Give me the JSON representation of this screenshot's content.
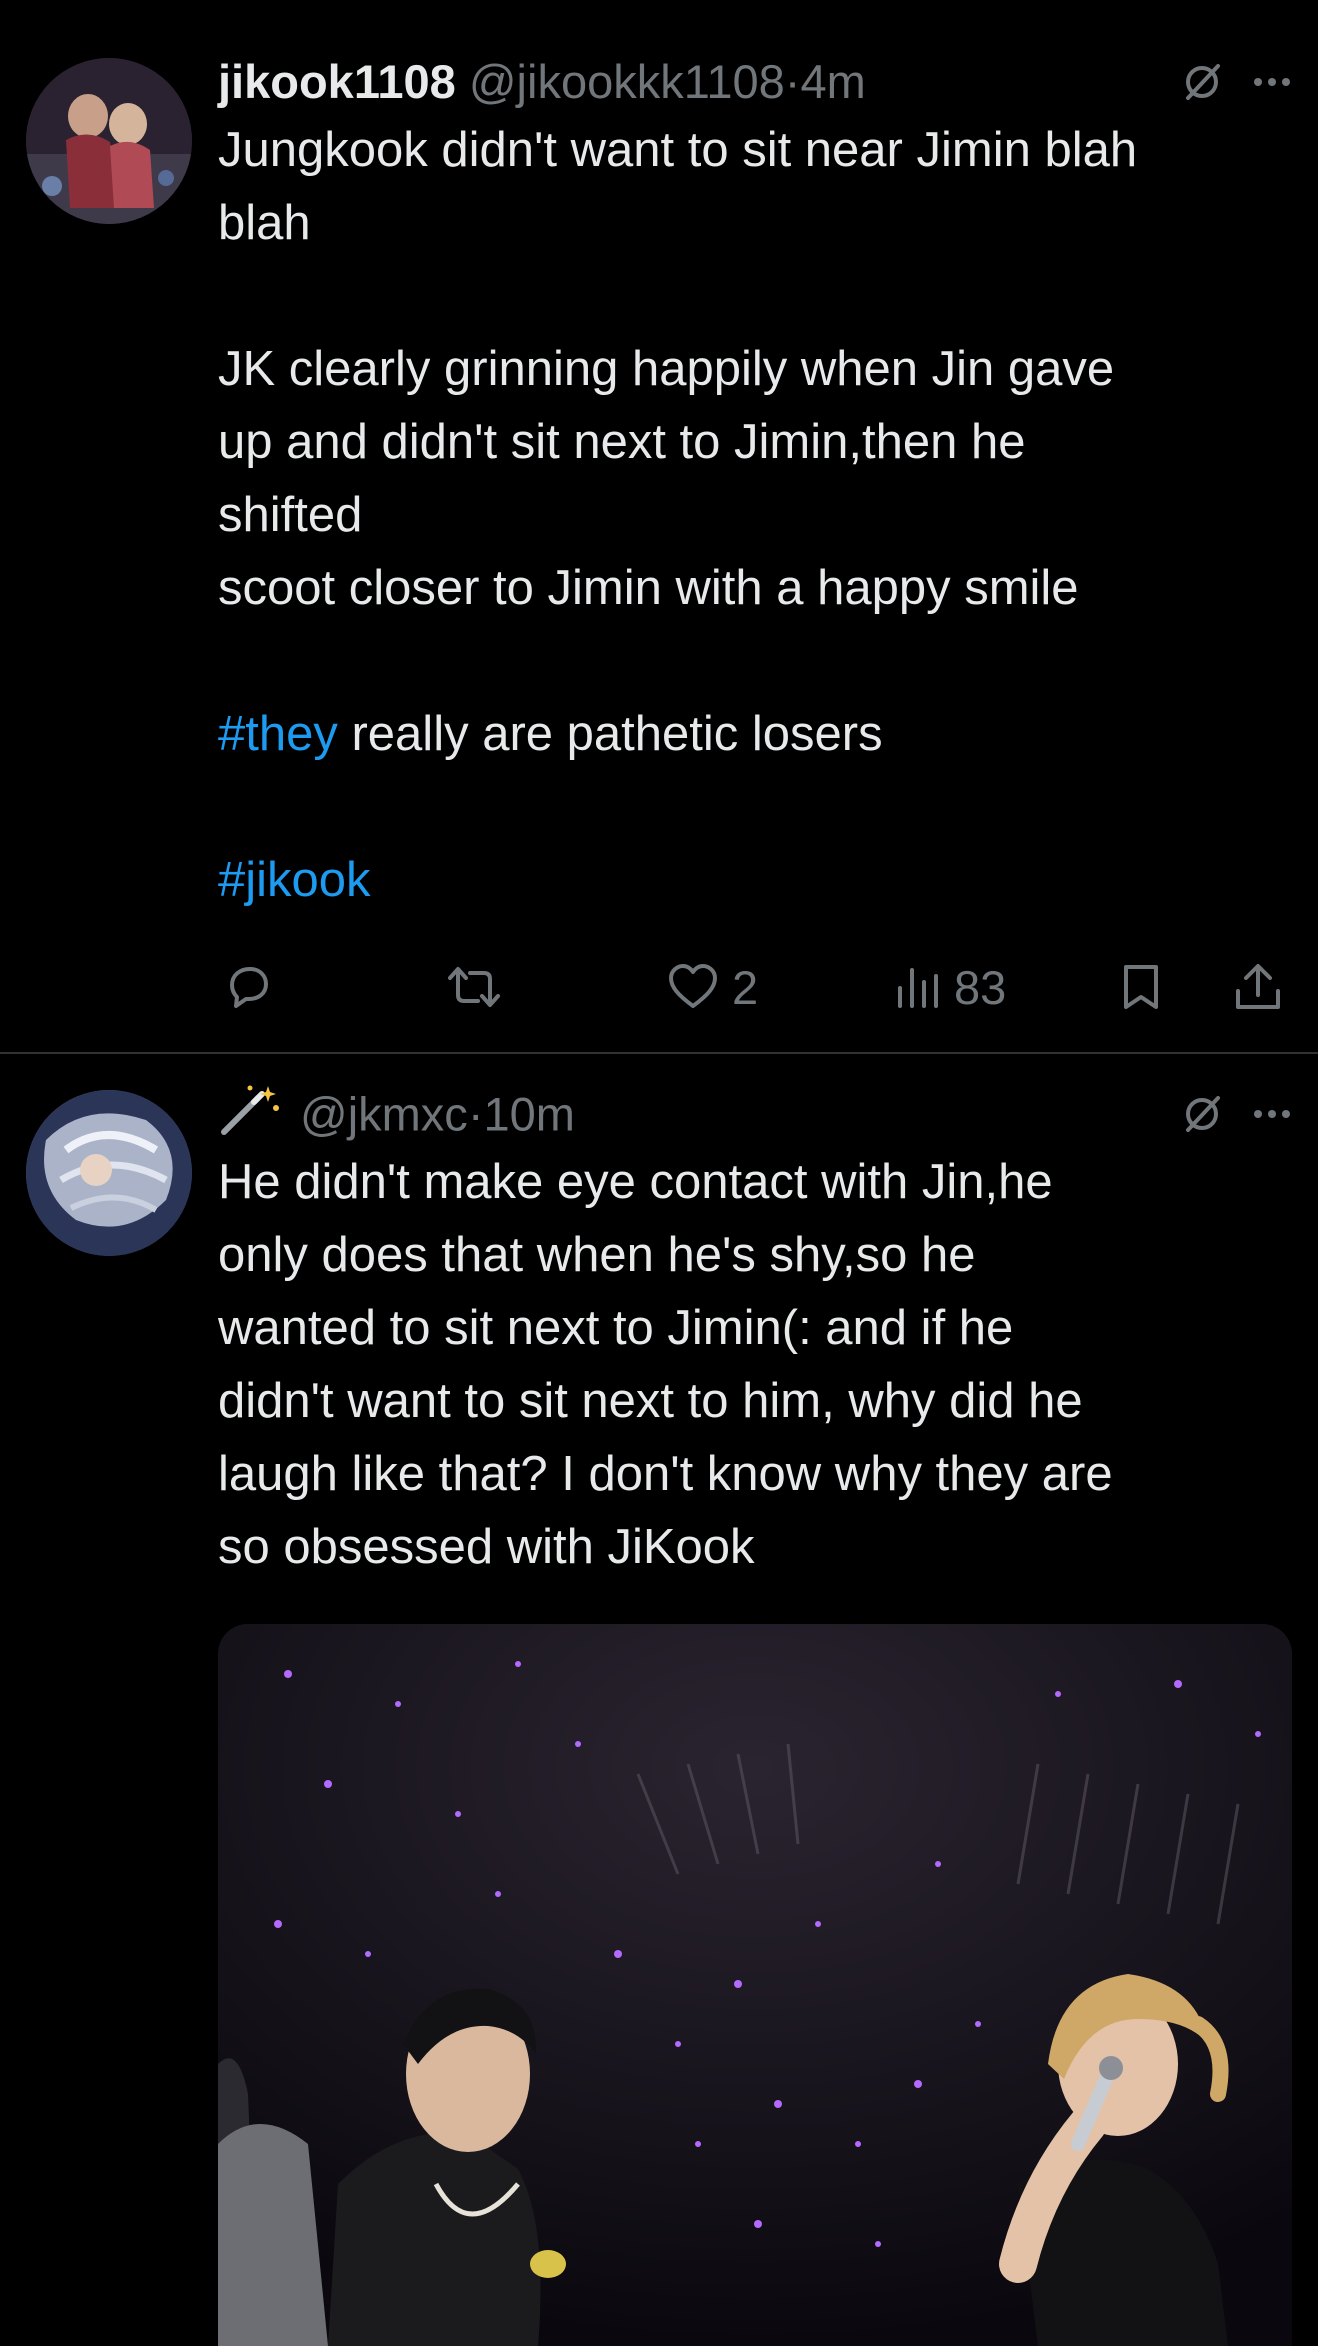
{
  "tweets": [
    {
      "display_name": "jikook1108",
      "handle": "@jikookkk1108",
      "separator": "·",
      "time": "4m",
      "lines": [
        {
          "parts": [
            {
              "text": "Jungkook didn't want to sit near Jimin blah",
              "hashtag": false
            }
          ]
        },
        {
          "parts": [
            {
              "text": "blah",
              "hashtag": false
            }
          ]
        },
        {
          "parts": [
            {
              "text": "",
              "hashtag": false
            }
          ]
        },
        {
          "parts": [
            {
              "text": "JK clearly grinning happily when Jin gave",
              "hashtag": false
            }
          ]
        },
        {
          "parts": [
            {
              "text": "up and didn't sit next to Jimin,then he",
              "hashtag": false
            }
          ]
        },
        {
          "parts": [
            {
              "text": "shifted",
              "hashtag": false
            }
          ]
        },
        {
          "parts": [
            {
              "text": "scoot closer to Jimin with a happy smile",
              "hashtag": false
            }
          ]
        },
        {
          "parts": [
            {
              "text": "",
              "hashtag": false
            }
          ]
        },
        {
          "parts": [
            {
              "text": "#they",
              "hashtag": true
            },
            {
              "text": " really are pathetic losers",
              "hashtag": false
            }
          ]
        },
        {
          "parts": [
            {
              "text": "",
              "hashtag": false
            }
          ]
        },
        {
          "parts": [
            {
              "text": "#jikook",
              "hashtag": true
            }
          ]
        }
      ],
      "actions": {
        "reply_count": "",
        "retweet_count": "",
        "like_count": "2",
        "view_count": "83"
      }
    },
    {
      "display_name_icon": "magic-wand-icon",
      "handle": "@jkmxc",
      "separator": "·",
      "time": "10m",
      "lines": [
        {
          "parts": [
            {
              "text": "He didn't make eye contact with Jin,he",
              "hashtag": false
            }
          ]
        },
        {
          "parts": [
            {
              "text": "only does that when he's shy,so he",
              "hashtag": false
            }
          ]
        },
        {
          "parts": [
            {
              "text": "wanted to sit next to Jimin(: and if he",
              "hashtag": false
            }
          ]
        },
        {
          "parts": [
            {
              "text": "didn't want to sit next to him, why did he",
              "hashtag": false
            }
          ]
        },
        {
          "parts": [
            {
              "text": "laugh like that? I don't know why they are",
              "hashtag": false
            }
          ]
        },
        {
          "parts": [
            {
              "text": "so obsessed with JiKook",
              "hashtag": false
            }
          ]
        }
      ]
    }
  ],
  "colors": {
    "background": "#000000",
    "text": "#e7e9ea",
    "muted": "#71767b",
    "hashtag": "#1d9bf0",
    "divider": "#2f3336"
  },
  "icons": [
    "grok-icon",
    "more-icon",
    "reply-icon",
    "retweet-icon",
    "like-icon",
    "views-icon",
    "bookmark-icon",
    "share-icon",
    "magic-wand-icon"
  ]
}
